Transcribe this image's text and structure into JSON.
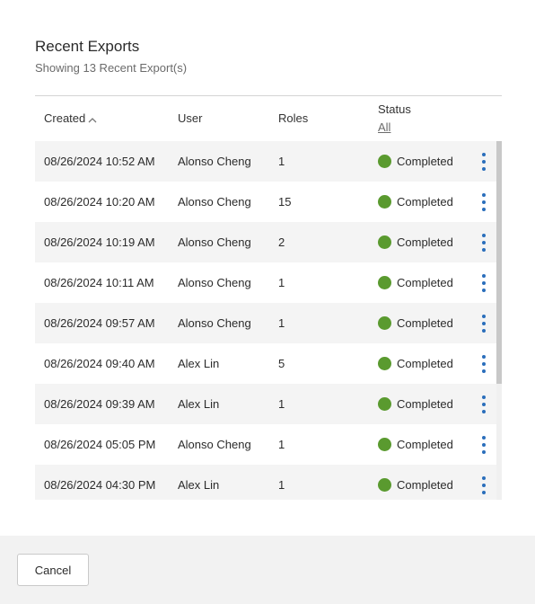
{
  "dialog": {
    "title": "Recent Exports",
    "subtitle": "Showing 13 Recent Export(s)"
  },
  "table": {
    "columns": {
      "created": "Created",
      "user": "User",
      "roles": "Roles",
      "status": "Status",
      "status_filter": "All"
    },
    "rows": [
      {
        "created": "08/26/2024 10:52 AM",
        "user": "Alonso Cheng",
        "roles": "1",
        "status": "Completed"
      },
      {
        "created": "08/26/2024 10:20 AM",
        "user": "Alonso Cheng",
        "roles": "15",
        "status": "Completed"
      },
      {
        "created": "08/26/2024 10:19 AM",
        "user": "Alonso Cheng",
        "roles": "2",
        "status": "Completed"
      },
      {
        "created": "08/26/2024 10:11 AM",
        "user": "Alonso Cheng",
        "roles": "1",
        "status": "Completed"
      },
      {
        "created": "08/26/2024 09:57 AM",
        "user": "Alonso Cheng",
        "roles": "1",
        "status": "Completed"
      },
      {
        "created": "08/26/2024 09:40 AM",
        "user": "Alex Lin",
        "roles": "5",
        "status": "Completed"
      },
      {
        "created": "08/26/2024 09:39 AM",
        "user": "Alex Lin",
        "roles": "1",
        "status": "Completed"
      },
      {
        "created": "08/26/2024 05:05 PM",
        "user": "Alonso Cheng",
        "roles": "1",
        "status": "Completed"
      },
      {
        "created": "08/26/2024 04:30 PM",
        "user": "Alex Lin",
        "roles": "1",
        "status": "Completed"
      }
    ]
  },
  "footer": {
    "cancel_label": "Cancel"
  },
  "colors": {
    "status_completed": "#5a9a2f",
    "kebab_accent": "#2a6ebb"
  },
  "icons": {
    "sort": "chevron-up-icon",
    "row_actions": "kebab-menu-icon",
    "status": "status-dot-icon"
  }
}
